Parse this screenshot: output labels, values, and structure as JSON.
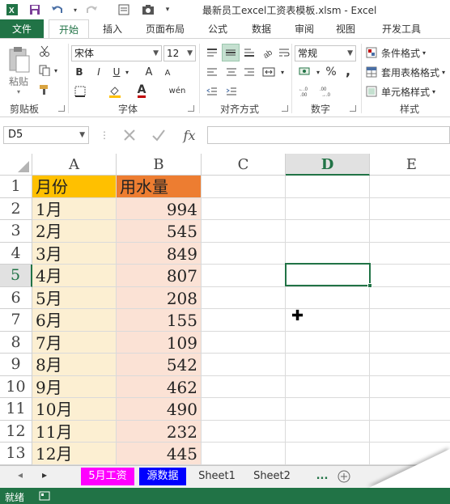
{
  "title": "最新员工excel工资表模板.xlsm - Excel",
  "colors": {
    "brand": "#217346",
    "header_a": "#ffc000",
    "header_b": "#ed7d31",
    "col_a_fill": "#fcefd2",
    "col_b_fill": "#fbe2d5",
    "tab_pink": "#ff00ff",
    "tab_blue": "#0000ff"
  },
  "quick_access": {
    "icons": [
      "excel-logo-icon",
      "save-icon",
      "undo-icon",
      "redo-icon",
      "form-icon",
      "camera-icon"
    ]
  },
  "ribbon_tabs": [
    "文件",
    "开始",
    "插入",
    "页面布局",
    "公式",
    "数据",
    "审阅",
    "视图",
    "开发工具"
  ],
  "ribbon": {
    "clipboard": {
      "label": "剪贴板",
      "paste": "粘贴"
    },
    "font": {
      "label": "字体",
      "name": "宋体",
      "size": "12",
      "bold": "B",
      "italic": "I",
      "underline": "U",
      "grow": "A",
      "shrink": "A",
      "font_color": "A",
      "phonetic": "wén"
    },
    "alignment": {
      "label": "对齐方式"
    },
    "number": {
      "label": "数字",
      "format": "常规",
      "percent": "%",
      "comma": ","
    },
    "styles": {
      "label": "样式",
      "conditional": "条件格式",
      "table": "套用表格格式",
      "cell": "单元格样式"
    }
  },
  "formula_bar": {
    "name_box": "D5",
    "formula": ""
  },
  "columns": [
    "A",
    "B",
    "C",
    "D",
    "E"
  ],
  "rows": [
    "1",
    "2",
    "3",
    "4",
    "5",
    "6",
    "7",
    "8",
    "9",
    "10",
    "11",
    "12",
    "13"
  ],
  "table": {
    "headers": [
      "月份",
      "用水量"
    ],
    "months": [
      "1月",
      "2月",
      "3月",
      "4月",
      "5月",
      "6月",
      "7月",
      "8月",
      "9月",
      "10月",
      "11月",
      "12月"
    ],
    "values": [
      "994",
      "545",
      "849",
      "807",
      "208",
      "155",
      "109",
      "542",
      "462",
      "490",
      "232",
      "445"
    ]
  },
  "active_cell": "D5",
  "sheet_tabs": [
    "5月工资",
    "源数据",
    "Sheet1",
    "Sheet2"
  ],
  "sheet_more": "...",
  "status": {
    "text": "就绪"
  }
}
